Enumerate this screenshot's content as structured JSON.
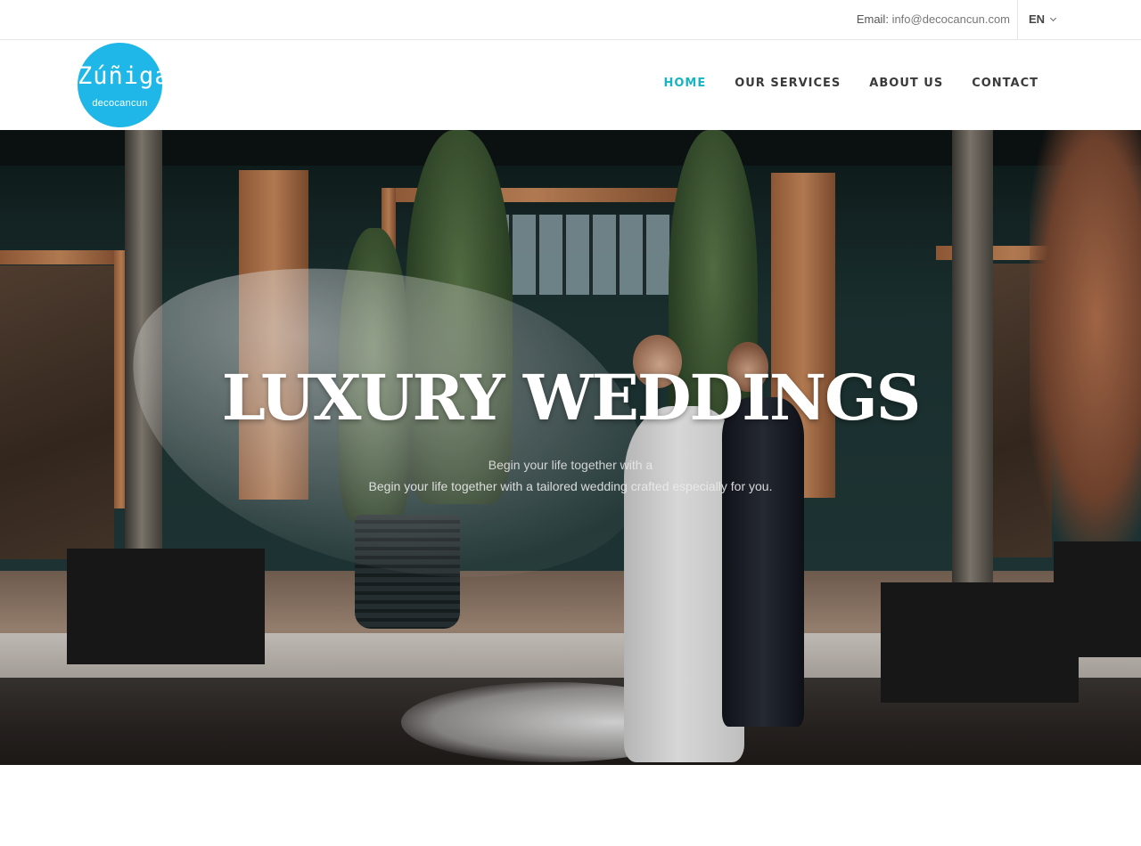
{
  "topbar": {
    "email_label": "Email:",
    "email_value": "info@decocancun.com",
    "language": "EN"
  },
  "header": {
    "logo": {
      "name": "Zúñiga",
      "sub": "decocancun",
      "color": "#1fb7e7"
    },
    "nav": [
      {
        "label": "HOME",
        "active": true
      },
      {
        "label": "OUR SERVICES",
        "active": false
      },
      {
        "label": "ABOUT US",
        "active": false
      },
      {
        "label": "CONTACT",
        "active": false
      }
    ],
    "accent_color": "#19b4c1"
  },
  "hero": {
    "title": "LUXURY WEDDINGS",
    "subtitle_line1": "Begin your life together with a",
    "subtitle_line2": "Begin your life together with a tailored wedding crafted especially for you."
  }
}
